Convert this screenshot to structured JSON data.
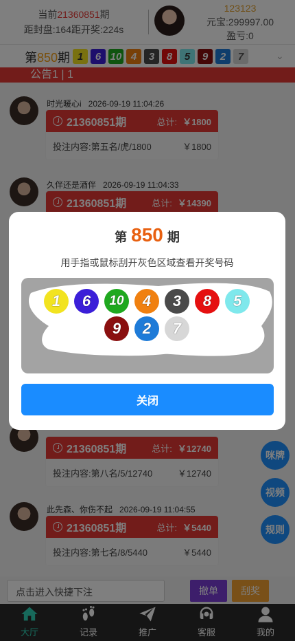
{
  "header": {
    "current_prefix": "当前",
    "current_issue": "21360851",
    "current_suffix": "期",
    "countdown": "距封盘:164距开奖:224s",
    "user_id": "123123",
    "balance": "元宝:299997.00",
    "profit": "盈亏:0"
  },
  "issue_bar": {
    "prefix": "第",
    "issue": "850",
    "suffix": "期",
    "numbers": [
      "1",
      "6",
      "10",
      "4",
      "3",
      "8",
      "5",
      "9",
      "2",
      "7"
    ]
  },
  "colors": {
    "n1": "#f2e320",
    "n2": "#1e7bd8",
    "n3": "#4a4a4a",
    "n4": "#f08010",
    "n5": "#7fe8ec",
    "n6": "#3b1fd8",
    "n7": "#d7d7d7",
    "n8": "#e51010",
    "n9": "#8a0f0f",
    "n10": "#1fa81f"
  },
  "notice": "公告1  |  1",
  "messages": [
    {
      "name": "时光暖心i",
      "time": "2026-09-19 11:04:26",
      "issue": "21360851期",
      "total_label": "总计:",
      "total": "￥1800",
      "content": "投注内容:第五名/虎/1800",
      "amount": "￥1800"
    },
    {
      "name": "久伴还是酒伴",
      "time": "2026-09-19 11:04:33",
      "issue": "21360851期",
      "total_label": "总计:",
      "total": "￥14390",
      "content": "",
      "amount": ""
    },
    {
      "name": "",
      "time": "",
      "issue": "21360851期",
      "total_label": "总计:",
      "total": "￥12740",
      "content": "投注内容:第八名/5/12740",
      "amount": "￥12740"
    },
    {
      "name": "此先森、你伤不起",
      "time": "2026-09-19 11:04:55",
      "issue": "21360851期",
      "total_label": "总计:",
      "total": "￥5440",
      "content": "投注内容:第七名/8/5440",
      "amount": "￥5440"
    }
  ],
  "bottom_bar": {
    "input_placeholder": "点击进入快捷下注",
    "cancel_label": "撤单",
    "scratch_label": "刮奖"
  },
  "fabs": [
    "咪牌",
    "视频",
    "规则"
  ],
  "tabs": [
    {
      "label": "大厅",
      "icon": "home-icon"
    },
    {
      "label": "记录",
      "icon": "footprint-icon"
    },
    {
      "label": "推广",
      "icon": "paper-plane-icon"
    },
    {
      "label": "客服",
      "icon": "headset-icon"
    },
    {
      "label": "我的",
      "icon": "user-icon"
    }
  ],
  "modal": {
    "title_prefix": "第",
    "issue": "850",
    "title_suffix": "期",
    "subtitle": "用手指或鼠标刮开灰色区域查看开奖号码",
    "numbers": [
      "1",
      "6",
      "10",
      "4",
      "3",
      "8",
      "5",
      "9",
      "2",
      "7"
    ],
    "close_label": "关闭"
  }
}
